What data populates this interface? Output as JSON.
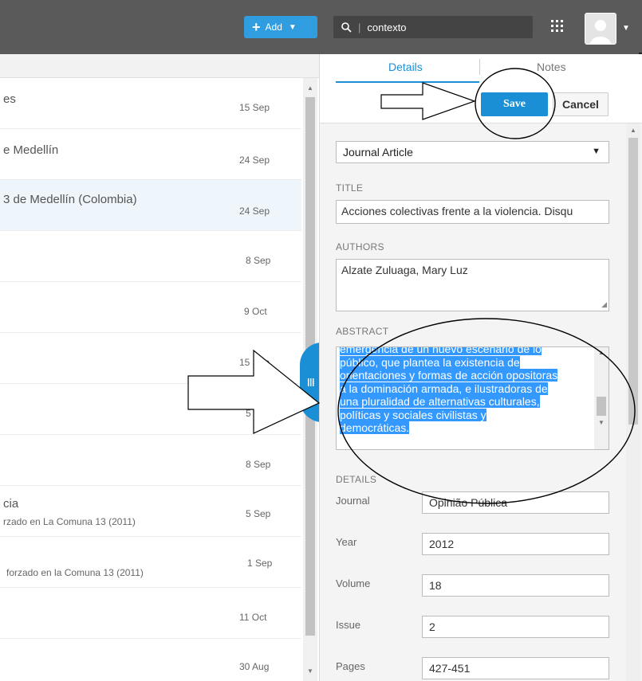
{
  "topbar": {
    "add_label": "Add",
    "search_value": "contexto"
  },
  "list": {
    "items": [
      {
        "title": "es",
        "sub": "",
        "date": "15 Sep"
      },
      {
        "title": "e Medellín",
        "sub": "",
        "date": "24 Sep"
      },
      {
        "title": "3 de Medellín (Colombia)",
        "sub": "",
        "date": "24 Sep"
      },
      {
        "title": "",
        "sub": "",
        "date": "8 Sep"
      },
      {
        "title": "",
        "sub": "",
        "date": "9 Oct"
      },
      {
        "title": "",
        "sub": "",
        "date": "15 Sep"
      },
      {
        "title": "",
        "sub": "",
        "date": "5 Sep"
      },
      {
        "title": "",
        "sub": "",
        "date": "8 Sep"
      },
      {
        "title": "cia",
        "sub": "rzado en La Comuna 13 (2011)",
        "date": "5 Sep"
      },
      {
        "title": "",
        "sub": "forzado en la Comuna 13 (2011)",
        "date": "1 Sep"
      },
      {
        "title": "",
        "sub": "",
        "date": "11 Oct"
      },
      {
        "title": "",
        "sub": "",
        "date": "30 Aug"
      }
    ]
  },
  "detail": {
    "tabs": {
      "details": "Details",
      "notes": "Notes"
    },
    "save_label": "Save",
    "cancel_label": "Cancel",
    "type_value": "Journal Article",
    "title_label": "TITLE",
    "title_value": "Acciones colectivas frente a la violencia. Disqu",
    "authors_label": "AUTHORS",
    "authors_value": "Alzate Zuluaga, Mary Luz",
    "abstract_label": "ABSTRACT",
    "abstract_lines": [
      "emergencia de un nuevo escenario de lo",
      "público, que plantea la existencia de",
      "orientaciones y formas de acción opositoras",
      "a la dominación armada, e ilustradoras de",
      "una pluralidad de alternativas culturales,",
      "políticas y sociales civilistas y",
      "democráticas."
    ],
    "details_label": "DETAILS",
    "journal_label": "Journal",
    "journal_value": "Opinião Pública",
    "year_label": "Year",
    "year_value": "2012",
    "volume_label": "Volume",
    "volume_value": "18",
    "issue_label": "Issue",
    "issue_value": "2",
    "pages_label": "Pages",
    "pages_value": "427-451"
  },
  "colors": {
    "accent": "#1a8fd6",
    "topbar": "#5a5a5a",
    "selection": "#3399ff"
  }
}
